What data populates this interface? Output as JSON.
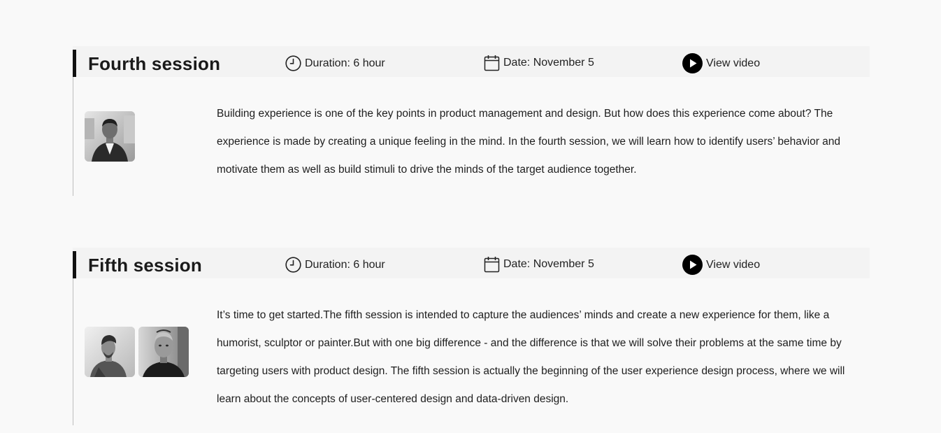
{
  "sessions": [
    {
      "title": "Fourth session",
      "duration": "Duration: 6 hour",
      "date": "Date: November 5",
      "video_label": "View video",
      "description": "Building experience is one of the key points in product management and design. But how does this experience come about? The experience is made by creating a unique feeling in the mind. In the fourth session, we will learn how to identify users’ behavior and motivate them as well as build stimuli to drive the minds of the target audience together.",
      "speakers_count": 1
    },
    {
      "title": "Fifth session",
      "duration": "Duration: 6 hour",
      "date": "Date: November 5",
      "video_label": "View video",
      "description": "It’s time to get started.The fifth session is intended to capture the audiences’ minds and create a new experience for them, like a humorist, sculptor or painter.But with one big difference - and the difference is that we will solve their problems at the same time by targeting users with product design. The fifth session is actually the beginning of the user experience design process, where we will learn about the concepts of user-centered design and data-driven design.",
      "speakers_count": 2
    }
  ],
  "icons": {
    "duration": "clock-icon",
    "date": "calendar-icon",
    "video": "play-icon"
  },
  "colors": {
    "background": "#f9f9f9",
    "header_bar": "#f3f3f3",
    "accent": "#111111",
    "timeline_line": "#bdbdbd",
    "text": "#1e1e1e"
  }
}
